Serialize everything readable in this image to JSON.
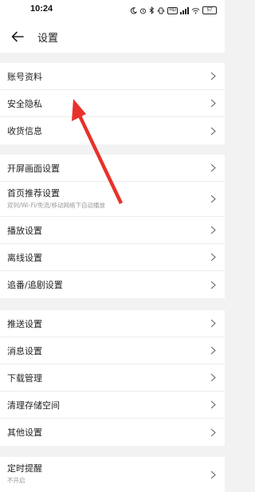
{
  "status_bar": {
    "time": "10:24",
    "hd_badge": "HD",
    "battery": "57"
  },
  "header": {
    "title": "设置"
  },
  "groups": [
    {
      "items": [
        {
          "label": "账号资料"
        },
        {
          "label": "安全隐私"
        },
        {
          "label": "收货信息"
        }
      ]
    },
    {
      "items": [
        {
          "label": "开屏画面设置"
        },
        {
          "label": "首页推荐设置",
          "sublabel": "双列/Wi-Fi/免流/移动网络下自动播放"
        },
        {
          "label": "播放设置"
        },
        {
          "label": "离线设置"
        },
        {
          "label": "追番/追剧设置"
        }
      ]
    },
    {
      "items": [
        {
          "label": "推送设置"
        },
        {
          "label": "消息设置"
        },
        {
          "label": "下载管理"
        },
        {
          "label": "清理存储空间"
        },
        {
          "label": "其他设置"
        }
      ]
    },
    {
      "items": [
        {
          "label": "定时提醒",
          "sublabel": "不开启"
        }
      ]
    }
  ],
  "colors": {
    "annotation_arrow": "#e8312a",
    "background": "#f2f2f2"
  }
}
